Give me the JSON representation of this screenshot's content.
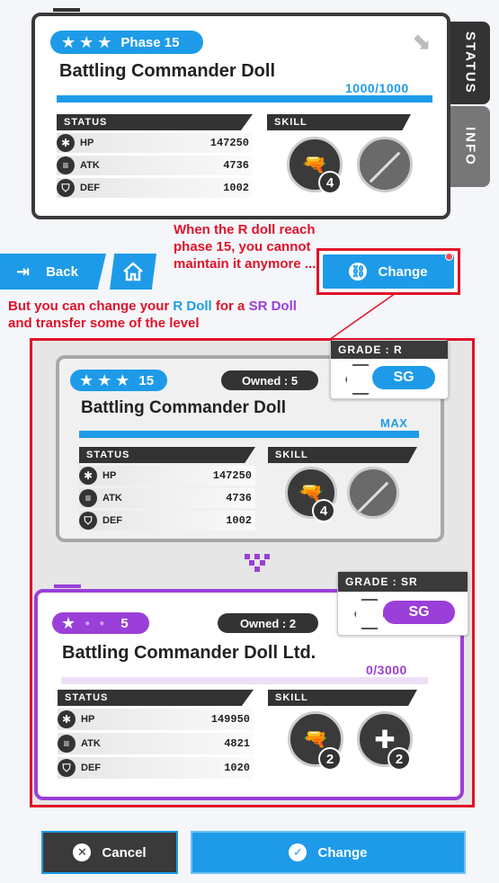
{
  "top": {
    "phase_label": "Phase 15",
    "stars": 3,
    "name": "Battling Commander Doll",
    "exp": "1000/1000",
    "exp_fraction": 1.0,
    "status_header": "STATUS",
    "skill_header": "SKILL",
    "stats": [
      {
        "label": "HP",
        "value": "147250",
        "icon": "hp-icon"
      },
      {
        "label": "ATK",
        "value": "4736",
        "icon": "atk-icon"
      },
      {
        "label": "DEF",
        "value": "1002",
        "icon": "def-icon"
      }
    ],
    "skill_level": "4",
    "tabs": {
      "status": "STATUS",
      "info": "INFO"
    }
  },
  "nav": {
    "back_label": "Back"
  },
  "annotations": {
    "note1": "When the R doll reach phase 15, you cannot maintain it anymore ...",
    "note2_a": "But you can change your ",
    "note2_r": "R Doll",
    "note2_b": " for a ",
    "note2_sr": "SR Doll",
    "note2_c": "and transfer some of the level"
  },
  "change_top_label": "Change",
  "r_doll": {
    "stars": 3,
    "phase": "15",
    "owned": "Owned : 5",
    "name": "Battling Commander Doll",
    "exp": "MAX",
    "status_header": "STATUS",
    "skill_header": "SKILL",
    "stats": [
      {
        "label": "HP",
        "value": "147250"
      },
      {
        "label": "ATK",
        "value": "4736"
      },
      {
        "label": "DEF",
        "value": "1002"
      }
    ],
    "skill_level": "4",
    "grade_label": "GRADE :  R",
    "grade_type": "SG"
  },
  "sr_doll": {
    "stars": 1,
    "phase": "5",
    "owned": "Owned : 2",
    "name": "Battling Commander Doll Ltd.",
    "exp": "0/3000",
    "status_header": "STATUS",
    "skill_header": "SKILL",
    "stats": [
      {
        "label": "HP",
        "value": "149950"
      },
      {
        "label": "ATK",
        "value": "4821"
      },
      {
        "label": "DEF",
        "value": "1020"
      }
    ],
    "skill1_level": "2",
    "skill2_level": "2",
    "grade_label": "GRADE :  SR",
    "grade_type": "SG"
  },
  "buttons": {
    "cancel": "Cancel",
    "change": "Change"
  },
  "colors": {
    "blue": "#1e9be8",
    "purple": "#9a3fd8",
    "red": "#e0122a"
  }
}
